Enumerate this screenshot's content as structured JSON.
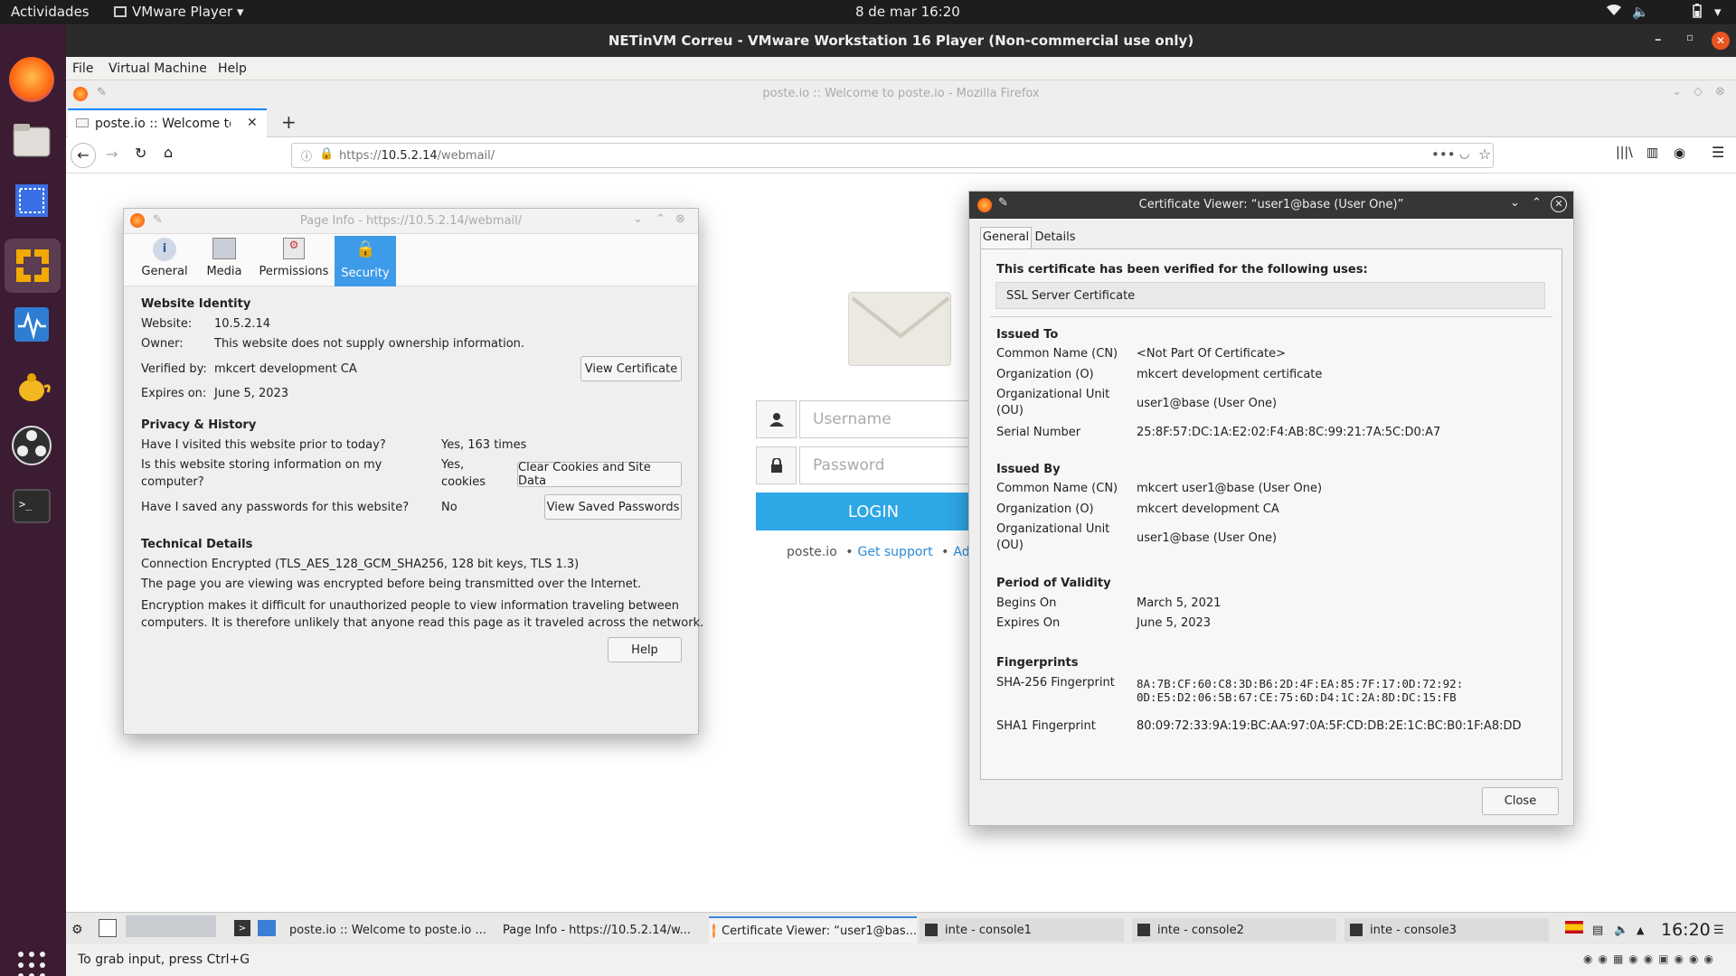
{
  "topbar": {
    "activities": "Actividades",
    "app": "VMware Player",
    "datetime": "8 de mar  16:20"
  },
  "vm": {
    "title": "NETinVM Correu - VMware Workstation 16 Player (Non-commercial use only)",
    "menu": [
      "File",
      "Virtual Machine",
      "Help"
    ]
  },
  "firefox": {
    "window_title": "poste.io :: Welcome to poste.io - Mozilla Firefox",
    "tab_label": "poste.io :: Welcome to poste.io",
    "url_prefix": "https://",
    "url_host": "10.5.2.14",
    "url_path": "/webmail/"
  },
  "poste": {
    "username_placeholder": "Username",
    "password_placeholder": "Password",
    "login": "LOGIN",
    "footer_brand": "poste.io",
    "footer_support": "Get support",
    "footer_admin": "Admini"
  },
  "page_info": {
    "title": "Page Info - https://10.5.2.14/webmail/",
    "tabs": [
      "General",
      "Media",
      "Permissions",
      "Security"
    ],
    "identity_heading": "Website Identity",
    "website_label": "Website:",
    "website_value": "10.5.2.14",
    "owner_label": "Owner:",
    "owner_value": "This website does not supply ownership information.",
    "verified_label": "Verified by:",
    "verified_value": "mkcert development CA",
    "view_cert": "View Certificate",
    "expires_label": "Expires on:",
    "expires_value": "June 5, 2023",
    "privacy_heading": "Privacy & History",
    "q1": "Have I visited this website prior to today?",
    "a1": "Yes, 163 times",
    "q2a": "Is this website storing information on my",
    "q2b": "computer?",
    "a2a": "Yes,",
    "a2b": "cookies",
    "clear_btn": "Clear Cookies and Site Data",
    "q3": "Have I saved any passwords for this website?",
    "a3": "No",
    "passwords_btn": "View Saved Passwords",
    "tech_heading": "Technical Details",
    "tech1": "Connection Encrypted (TLS_AES_128_GCM_SHA256, 128 bit keys, TLS 1.3)",
    "tech2": "The page you are viewing was encrypted before being transmitted over the Internet.",
    "tech3a": "Encryption makes it difficult for unauthorized people to view information traveling between",
    "tech3b": "computers. It is therefore unlikely that anyone read this page as it traveled across the network.",
    "help": "Help"
  },
  "cert": {
    "title": "Certificate Viewer: “user1@base (User One)”",
    "tabs": [
      "General",
      "Details"
    ],
    "verified_heading": "This certificate has been verified for the following uses:",
    "use": "SSL Server Certificate",
    "issued_to_heading": "Issued To",
    "cn_label": "Common Name (CN)",
    "to_cn": "<Not Part Of Certificate>",
    "o_label": "Organization (O)",
    "to_o": "mkcert development certificate",
    "ou_label_a": "Organizational Unit",
    "ou_label_b": "(OU)",
    "to_ou": "user1@base (User One)",
    "serial_label": "Serial Number",
    "serial": "25:8F:57:DC:1A:E2:02:F4:AB:8C:99:21:7A:5C:D0:A7",
    "issued_by_heading": "Issued By",
    "by_cn": "mkcert user1@base (User One)",
    "by_o": "mkcert development CA",
    "by_ou": "user1@base (User One)",
    "validity_heading": "Period of Validity",
    "begins_label": "Begins On",
    "begins": "March 5, 2021",
    "expires_label": "Expires On",
    "expires": "June 5, 2023",
    "fp_heading": "Fingerprints",
    "sha256_label": "SHA-256 Fingerprint",
    "sha256_a": "8A:7B:CF:60:C8:3D:B6:2D:4F:EA:85:7F:17:0D:72:92:",
    "sha256_b": "0D:E5:D2:06:5B:67:CE:75:6D:D4:1C:2A:8D:DC:15:FB",
    "sha1_label": "SHA1 Fingerprint",
    "sha1": "80:09:72:33:9A:19:BC:AA:97:0A:5F:CD:DB:2E:1C:BC:B0:1F:A8:DD",
    "close": "Close"
  },
  "taskbar": {
    "items": [
      "poste.io :: Welcome to poste.io ...",
      "Page Info - https://10.5.2.14/w...",
      "Certificate Viewer: “user1@bas...",
      "inte - console1",
      "inte - console2",
      "inte - console3"
    ],
    "clock": "16:20"
  },
  "status": "To grab input, press Ctrl+G",
  "colors": {
    "accent": "#0a84ff",
    "login": "#2ea7e6",
    "security_tab": "#3d9be9",
    "dock": "#3c1c33"
  }
}
